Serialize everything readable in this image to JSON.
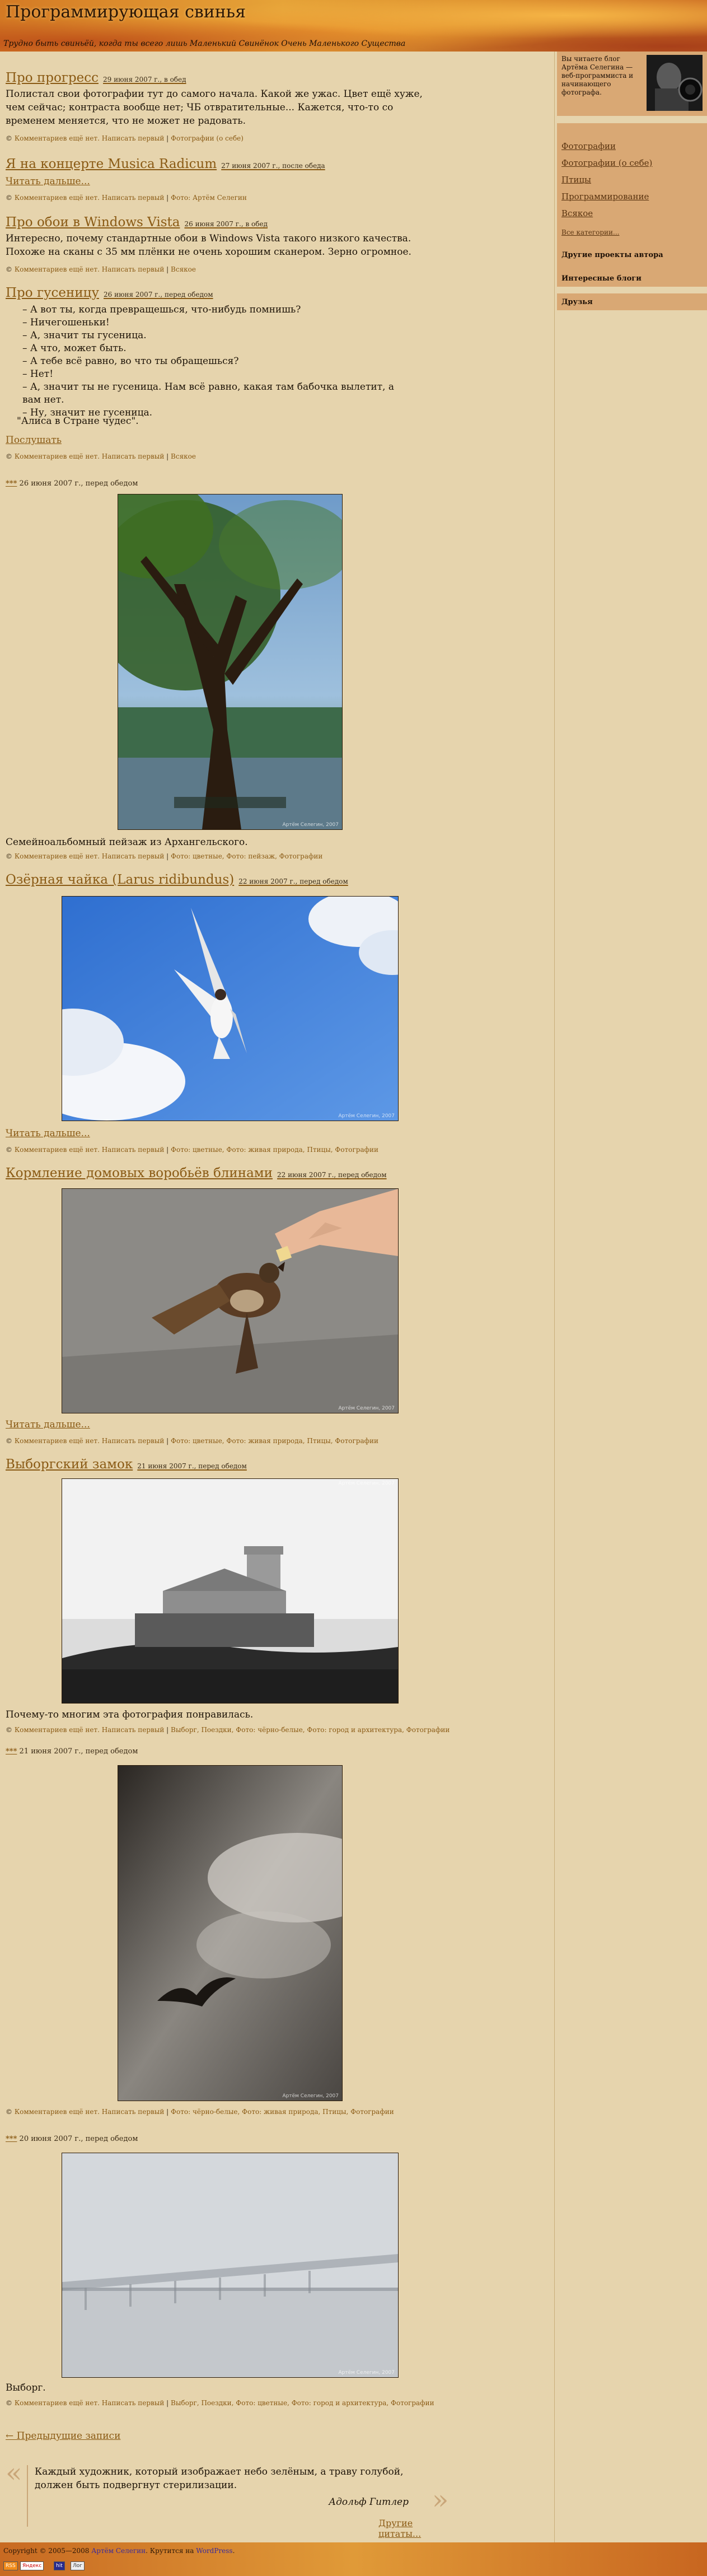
{
  "site": {
    "title": "Программирующая свинья",
    "subtitle": "Трудно быть свиньёй, когда ты всего лишь Маленький Свинёнок Очень Маленького Существа"
  },
  "posts": [
    {
      "title": "Про прогресс",
      "date": "29 июня 2007 г., в обед",
      "body": "Полистал свои фотографии тут до самого начала. Какой же ужас. Цвет ещё хуже, чем сейчас; контраста вообще нет; ЧБ отвратительные... Кажется, что-то со временем меняется, что не может не радовать.",
      "meta_comment": "Комментариев ещё нет. Написать первый",
      "meta_tags": "Фотографии (о себе)"
    },
    {
      "title": "Я на концерте Musica Radicum",
      "date": "27 июня 2007 г., после обеда",
      "readmore": "Читать дальше...",
      "meta_comment": "Комментариев ещё нет. Написать первый",
      "meta_tags": "Фото: Артём Селегин"
    },
    {
      "title": "Про обои в Windows Vista",
      "date": "26 июня 2007 г., в обед",
      "body": "Интересно, почему стандартные обои в Windows Vista такого низкого качества. Похоже на сканы с 35 мм плёнки не очень хорошим сканером. Зерно огромное.",
      "meta_comment": "Комментариев ещё нет. Написать первый",
      "meta_tags": "Всякое"
    },
    {
      "title": "Про гусеницу",
      "date": "26 июня 2007 г., перед обедом",
      "dialog": [
        "– А вот ты, когда превращешься, что-нибудь помнишь?",
        "– Ничегошеньки!",
        "– А, значит ты гусеница.",
        "– А что, может быть.",
        "– А тебе всё равно, во что ты обращешься?",
        "– Нет!",
        "– А, значит ты не гусеница. Нам всё равно, какая там бабочка вылетит, а вам нет.",
        "– Ну, значит не гусеница."
      ],
      "source": "\"Алиса в Стране чудес\".",
      "readmore": "Послушать",
      "meta_comment": "Комментариев ещё нет. Написать первый",
      "meta_tags": "Всякое"
    },
    {
      "title": "***",
      "date": "26 июня 2007 г., перед обедом",
      "body": "Семейноальбомный пейзаж из Архангельского.",
      "photo_credit": "Артём Селегин, 2007",
      "meta_comment": "Комментариев ещё нет. Написать первый",
      "meta_tags": "Фото: цветные, Фото: пейзаж, Фотографии"
    },
    {
      "title": "Озёрная чайка (Larus ridibundus)",
      "date": "22 июня 2007 г., перед обедом",
      "photo_credit": "Артём Селегин, 2007",
      "readmore": "Читать дальше...",
      "meta_comment": "Комментариев ещё нет. Написать первый",
      "meta_tags": "Фото: цветные, Фото: живая природа, Птицы, Фотографии"
    },
    {
      "title": "Кормление домовых воробьёв блинами",
      "date": "22 июня 2007 г., перед обедом",
      "photo_credit": "Артём Селегин, 2007",
      "readmore": "Читать дальше...",
      "meta_comment": "Комментариев ещё нет. Написать первый",
      "meta_tags": "Фото: цветные, Фото: живая природа, Птицы, Фотографии"
    },
    {
      "title": "Выборгский замок",
      "date": "21 июня 2007 г., перед обедом",
      "body": "Почему-то многим эта фотография понравилась.",
      "photo_credit": "Артём Селегин, 2007",
      "meta_comment": "Комментариев ещё нет. Написать первый",
      "meta_tags": "Выборг, Поездки, Фото: чёрно-белые, Фото: город и архитектура, Фотографии"
    },
    {
      "title": "***",
      "date": "21 июня 2007 г., перед обедом",
      "photo_credit": "Артём Селегин, 2007",
      "meta_comment": "Комментариев ещё нет. Написать первый",
      "meta_tags": "Фото: чёрно-белые, Фото: живая природа, Птицы, Фотографии"
    },
    {
      "title": "***",
      "date": "20 июня 2007 г., перед обедом",
      "body": "Выборг.",
      "photo_credit": "Артём Селегин, 2007",
      "meta_comment": "Комментариев ещё нет. Написать первый",
      "meta_tags": "Выборг, Поездки, Фото: цветные, Фото: город и архитектура, Фотографии"
    }
  ],
  "sidebar": {
    "about": "Вы читаете блог Артёма Селегина — веб-программиста и начинающего фотографа.",
    "menu": [
      "Фотографии",
      "Фотографии (о себе)",
      "Птицы",
      "Программирование",
      "Всякое"
    ],
    "all_tags": "Все категории...",
    "heads": [
      "Другие проекты автора",
      "Интересные блоги",
      "Друзья"
    ]
  },
  "bottom": {
    "prev": "← Предыдущие записи",
    "quote": "Каждый художник, который изображает небо зелёным, а траву голубой, должен быть подвергнут стерилизации.",
    "quote_author": "Адольф Гитлер",
    "more_quotes": "Другие цитаты..."
  },
  "footer": {
    "copyright": "Copyright © 2005—2008",
    "author": "Артём Селегин",
    "powered_prefix": ". Крутится на",
    "engine": "WordPress",
    "badges": [
      "RSS",
      "Яндекс",
      "hit",
      "Лог"
    ]
  }
}
